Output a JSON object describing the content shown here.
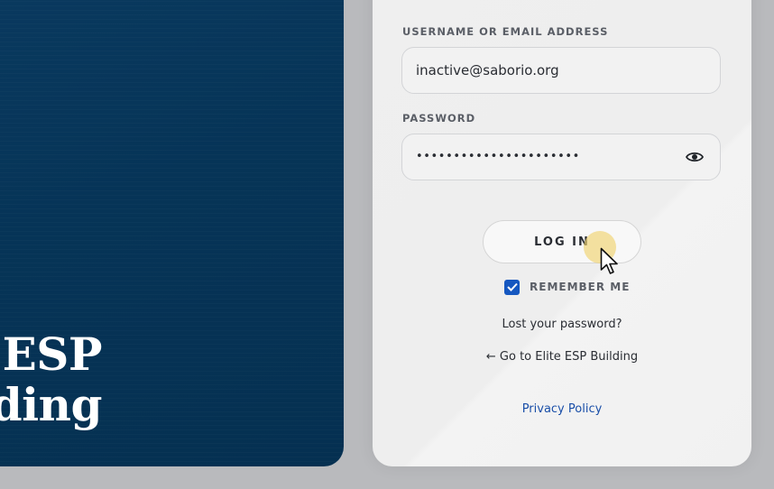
{
  "branding": {
    "title_line1": "ESP",
    "title_line2": "ding"
  },
  "form": {
    "username_label": "USERNAME OR EMAIL ADDRESS",
    "username_value": "inactive@saborio.org",
    "password_label": "PASSWORD",
    "password_masked": "••••••••••••••••••••••",
    "login_label": "LOG IN",
    "remember_label": "REMEMBER ME",
    "remember_checked": true
  },
  "links": {
    "lost_password": "Lost your password?",
    "go_to_site": "← Go to Elite ESP Building",
    "privacy": "Privacy Policy"
  },
  "colors": {
    "brand_panel": "#063457",
    "accent": "#1557c0",
    "link": "#1a4fa8",
    "click_highlight": "#f0d26e"
  },
  "icons": {
    "password_toggle": "eye-icon",
    "remember_check": "checkmark-icon",
    "pointer": "cursor-arrow-icon"
  }
}
